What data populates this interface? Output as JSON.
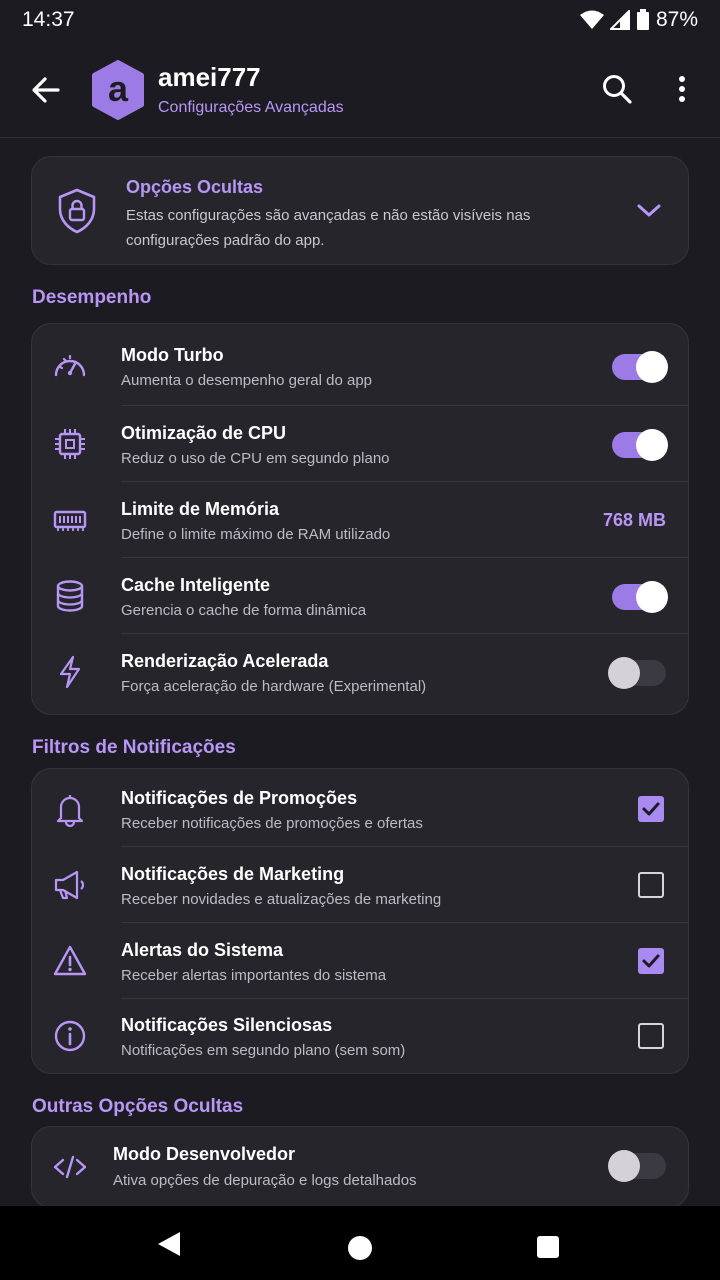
{
  "status": {
    "time": "14:37",
    "battery": "87%"
  },
  "header": {
    "title": "amei777",
    "subtitle": "Configurações Avançadas",
    "avatar_letter": "a"
  },
  "hidden_options": {
    "title": "Opções Ocultas",
    "description": "Estas configurações são avançadas e não estão visíveis nas configurações padrão do app."
  },
  "performance": {
    "title": "Desempenho",
    "items": [
      {
        "title": "Modo Turbo",
        "subtitle": "Aumenta o desempenho geral do app",
        "icon": "speedometer-icon",
        "enabled": true
      },
      {
        "title": "Otimização de CPU",
        "subtitle": "Reduz o uso de CPU em segundo plano",
        "icon": "cpu-icon",
        "enabled": true
      },
      {
        "title": "Limite de Memória",
        "subtitle": "Define o limite máximo de RAM utilizado",
        "icon": "memory-icon",
        "value": "768 MB"
      },
      {
        "title": "Cache Inteligente",
        "subtitle": "Gerencia o cache de forma dinâmica",
        "icon": "database-icon",
        "enabled": true
      },
      {
        "title": "Renderização Acelerada",
        "subtitle": "Força aceleração de hardware (Experimental)",
        "icon": "lightning-icon",
        "enabled": false
      }
    ]
  },
  "notifications": {
    "title": "Filtros de Notificações",
    "items": [
      {
        "title": "Notificações de Promoções",
        "subtitle": "Receber notificações de promoções e ofertas",
        "icon": "bell-icon",
        "checked": true
      },
      {
        "title": "Notificações de Marketing",
        "subtitle": "Receber novidades e atualizações de marketing",
        "icon": "megaphone-icon",
        "checked": false
      },
      {
        "title": "Alertas do Sistema",
        "subtitle": "Receber alertas importantes do sistema",
        "icon": "warning-icon",
        "checked": true
      },
      {
        "title": "Notificações Silenciosas",
        "subtitle": "Notificações em segundo plano (sem som)",
        "icon": "info-icon",
        "checked": false
      }
    ]
  },
  "other": {
    "title": "Outras Opções Ocultas",
    "items": [
      {
        "title": "Modo Desenvolvedor",
        "subtitle": "Ativa opções de depuração e logs detalhados",
        "icon": "code-icon",
        "enabled": false
      }
    ]
  },
  "colors": {
    "accent": "#b896f5",
    "background": "#1c1b21",
    "card": "#26252c"
  }
}
